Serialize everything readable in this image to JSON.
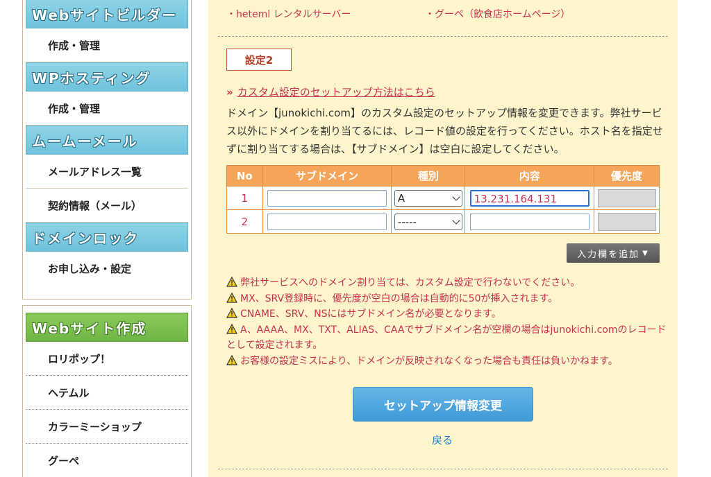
{
  "sidebar": {
    "sections": [
      {
        "title": "Webサイトビルダー",
        "items": [
          "作成・管理"
        ]
      },
      {
        "title": "WPホスティング",
        "items": [
          "作成・管理"
        ]
      },
      {
        "title": "ムームーメール",
        "items": [
          "メールアドレス一覧",
          "契約情報（メール）"
        ]
      },
      {
        "title": "ドメインロック",
        "items": [
          "お申し込み・設定"
        ]
      }
    ],
    "section2": {
      "title": "Webサイト作成",
      "items": [
        "ロリポップ！",
        "ヘテムル",
        "カラーミーショップ",
        "グーペ"
      ]
    }
  },
  "main": {
    "top_links": [
      "・heteml レンタルサーバー",
      "・グーペ（飲食店ホームページ）"
    ],
    "setting_label": "設定2",
    "setup_link_chevron": "»",
    "setup_link": "カスタム設定のセットアップ方法はこちら",
    "description": "ドメイン【junokichi.com】のカスタム設定のセットアップ情報を変更できます。弊社サービス以外にドメインを割り当てるには、レコード値の設定を行ってください。ホスト名を指定せずに割り当てする場合は、【サブドメイン】は空白に設定してください。",
    "table": {
      "headers": [
        "No",
        "サブドメイン",
        "種別",
        "内容",
        "優先度"
      ],
      "rows": [
        {
          "no": "1",
          "subdomain": "",
          "type": "A",
          "value": "13.231.164.131",
          "priority": ""
        },
        {
          "no": "2",
          "subdomain": "",
          "type": "-----",
          "value": "",
          "priority": ""
        }
      ]
    },
    "add_button": "入力欄を追加",
    "add_button_arrow": "▼",
    "warnings": [
      "弊社サービスへのドメイン割り当ては、カスタム設定で行わないでください。",
      "MX、SRV登録時に、優先度が空白の場合は自動的に50が挿入されます。",
      "CNAME、SRV、NSにはサブドメイン名が必要となります。",
      "A、AAAA、MX、TXT、ALIAS、CAAでサブドメイン名が空欄の場合はjunokichi.comのレコードとして設定されます。",
      "お客様の設定ミスにより、ドメインが反映されなくなった場合も責任は負いかねます。"
    ],
    "submit_button": "セットアップ情報変更",
    "back_link": "戻る"
  },
  "colors": {
    "accent": "#c8324f",
    "table_header": "#f4a55a",
    "submit": "#4fa6dd",
    "main_bg": "#fff5cc"
  }
}
